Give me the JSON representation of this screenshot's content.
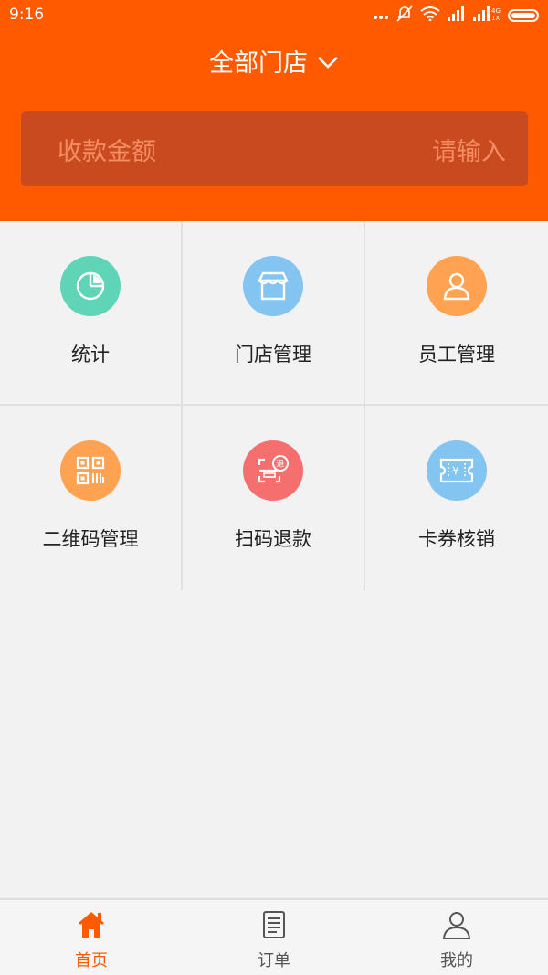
{
  "status_bar": {
    "time": "9:16",
    "network_label": "4G 1X"
  },
  "header": {
    "store_selector": "全部门店",
    "amount_label": "收款金额",
    "amount_placeholder": "请输入"
  },
  "grid_items": [
    {
      "label": "统计",
      "icon": "pie-chart-icon",
      "color": "#5fd4b6"
    },
    {
      "label": "门店管理",
      "icon": "store-icon",
      "color": "#83c4f1"
    },
    {
      "label": "员工管理",
      "icon": "person-icon",
      "color": "#ffa352"
    },
    {
      "label": "二维码管理",
      "icon": "qr-code-icon",
      "color": "#ffa352"
    },
    {
      "label": "扫码退款",
      "icon": "scan-refund-icon",
      "color": "#f66f6f"
    },
    {
      "label": "卡券核销",
      "icon": "coupon-icon",
      "color": "#83c4f1"
    }
  ],
  "bottom_nav": [
    {
      "label": "首页",
      "icon": "home-icon",
      "active": true
    },
    {
      "label": "订单",
      "icon": "order-icon",
      "active": false
    },
    {
      "label": "我的",
      "icon": "profile-icon",
      "active": false
    }
  ],
  "colors": {
    "primary": "#ff5a00",
    "input_bg": "#c94a1e"
  }
}
